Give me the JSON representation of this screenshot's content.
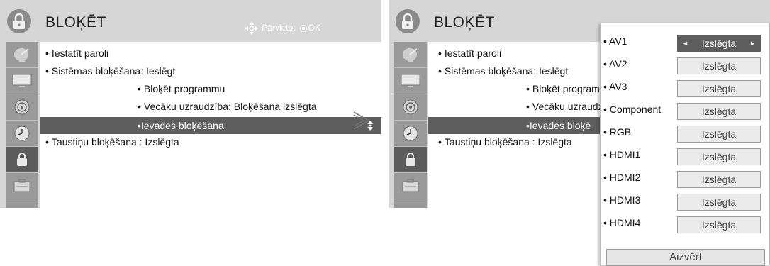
{
  "left_screen": {
    "title": "BLOĶĒT",
    "help": {
      "move": "Pārvietot",
      "ok": "OK"
    },
    "menu": {
      "set_password": "Iestatīt paroli",
      "system_lock": "Sistēmas bloķēšana: Ieslēgt",
      "block_program": "Bloķēt programmu",
      "parental": "Vecāku uzraudzība: Bloķēšana izslēgta",
      "input_block": "Ievades bloķēšana",
      "key_lock": "Taustiņu bloķēšana  : Izslēgta"
    }
  },
  "right_screen": {
    "title": "BLOĶĒT",
    "menu": {
      "set_password": "Iestatīt paroli",
      "system_lock": "Sistēmas bloķēšana: Ieslēgt",
      "block_program": "Bloķēt program",
      "parental": "Vecāku uzraudz",
      "input_block": "Ievades bloķē",
      "key_lock": "Taustiņu bloķēšana  : Izslēgta"
    }
  },
  "bullet": "•",
  "popup": {
    "rows": [
      {
        "label": "AV1",
        "value": "Izslēgta",
        "selected": true
      },
      {
        "label": "AV2",
        "value": "Izslēgta"
      },
      {
        "label": "AV3",
        "value": "Izslēgta"
      },
      {
        "label": "Component",
        "value": "Izslēgta"
      },
      {
        "label": "RGB",
        "value": "Izslēgta"
      },
      {
        "label": "HDMI1",
        "value": "Izslēgta"
      },
      {
        "label": "HDMI2",
        "value": "Izslēgta"
      },
      {
        "label": "HDMI3",
        "value": "Izslēgta"
      },
      {
        "label": "HDMI4",
        "value": "Izslēgta"
      }
    ],
    "close_label": "Aizvērt",
    "arrow_left": "◄",
    "arrow_right": "►"
  },
  "icons": {
    "title_icon": "padlock-icon",
    "categories": [
      "satellite-dish-icon",
      "tv-screen-icon",
      "speaker-icon",
      "clock-icon",
      "lock-icon",
      "settings-box-icon"
    ],
    "transition": "chevron-right-icon"
  },
  "colors": {
    "panel_gray": "#d6d6d6",
    "sidebar_gray": "#9a9a9a",
    "highlight": "#5e5e5e"
  }
}
